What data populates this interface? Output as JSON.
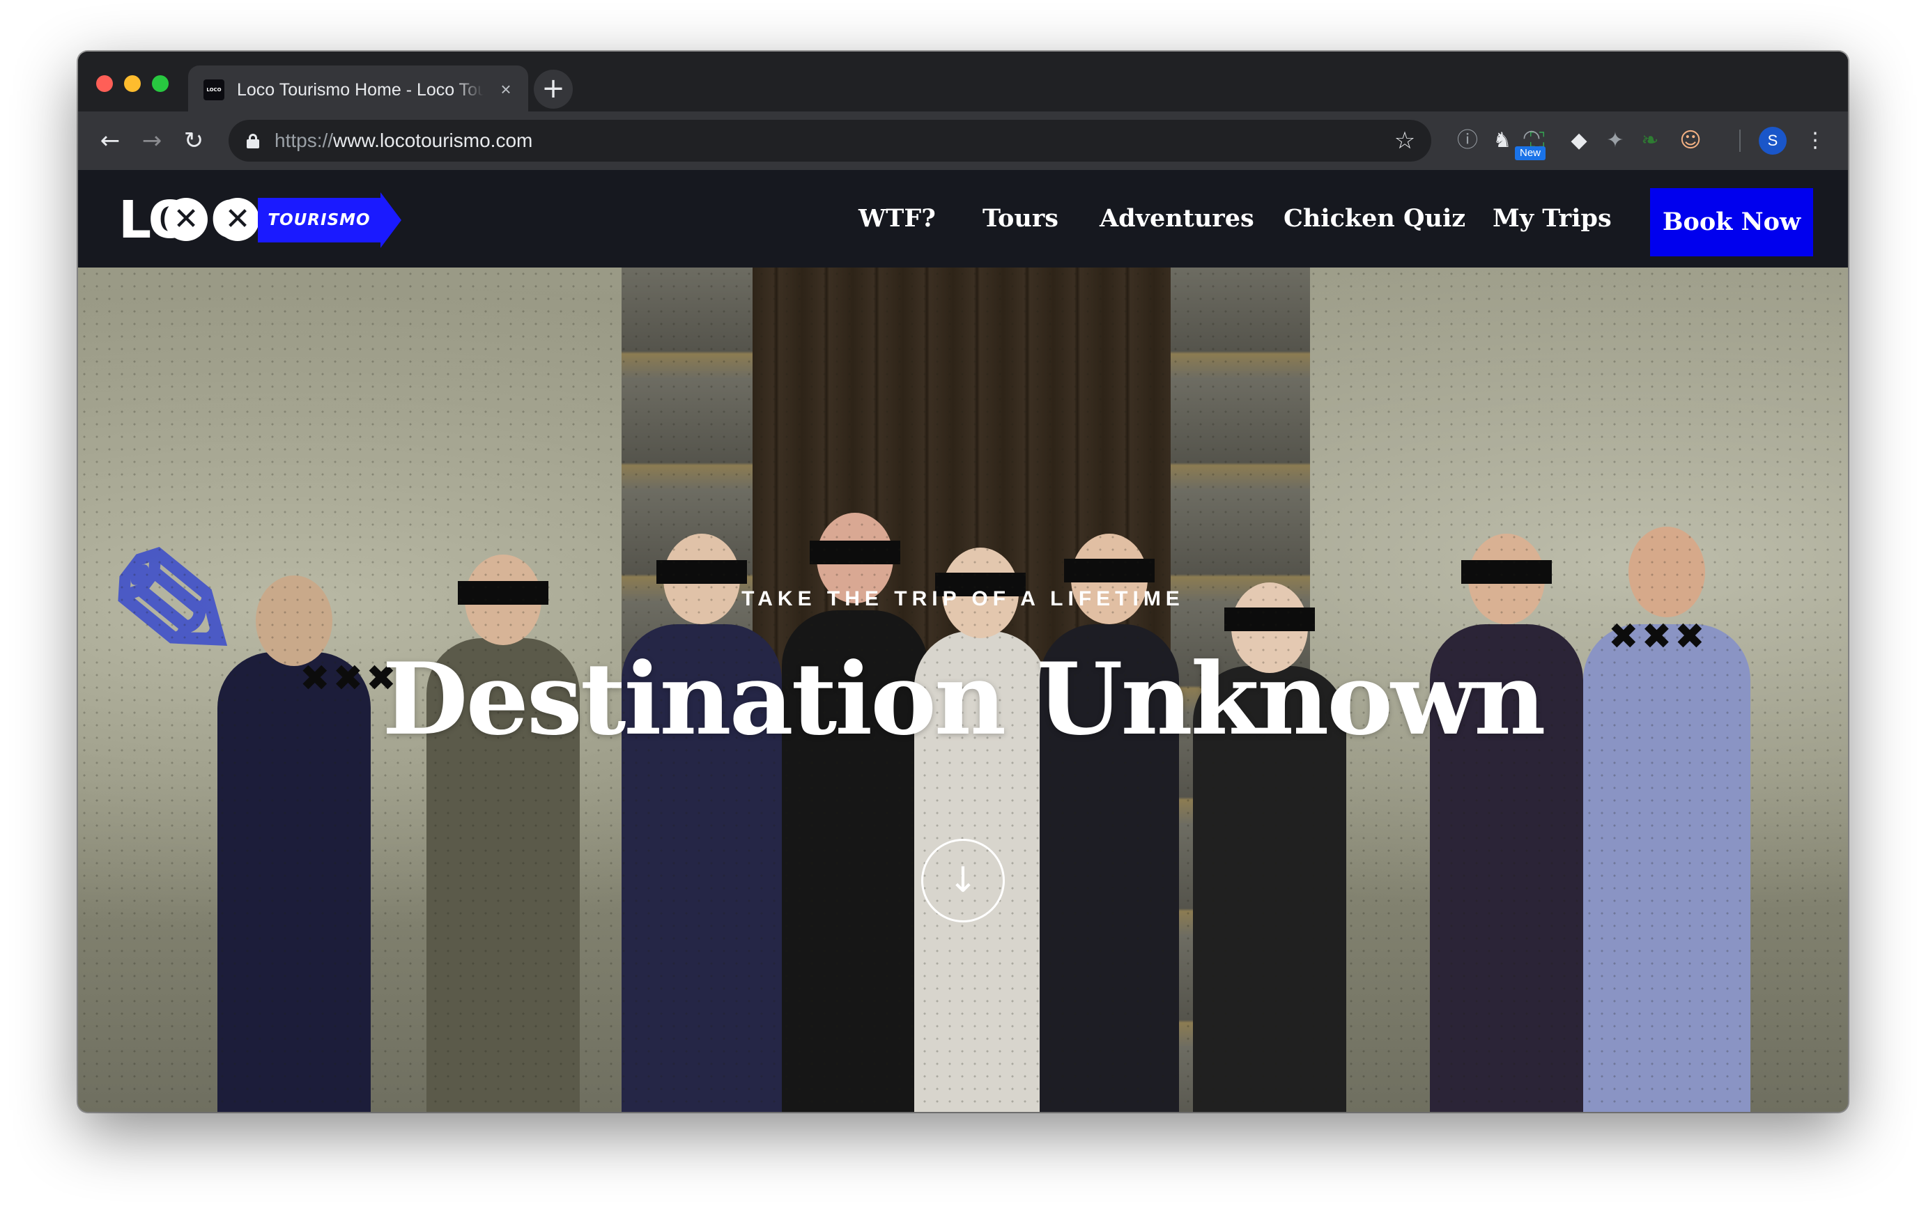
{
  "browser": {
    "tab": {
      "favicon_text": "LOCO",
      "title": "Loco Tourismo Home - Loco Tourismo",
      "close_icon": "×"
    },
    "new_tab_icon": "+",
    "nav": {
      "back": "←",
      "forward": "→",
      "reload": "↻"
    },
    "url": {
      "scheme": "https://",
      "host": "www.locotourismo.com"
    },
    "bookmark_icon": "☆",
    "extensions": [
      {
        "name": "info-extension-icon",
        "glyph": "ⓘ"
      },
      {
        "name": "horse-extension-icon",
        "glyph": "♞"
      },
      {
        "name": "screenshot-extension-icon",
        "glyph": "⛶"
      },
      {
        "name": "rainbow-extension-icon",
        "glyph": "◠"
      },
      {
        "name": "gem-extension-icon",
        "glyph": "◆"
      },
      {
        "name": "puzzle-extension-icon",
        "glyph": "✦"
      },
      {
        "name": "leaf-extension-icon",
        "glyph": "❧"
      },
      {
        "name": "face-extension-icon",
        "glyph": "☺"
      }
    ],
    "new_badge": "New",
    "profile_initial": "S",
    "menu_icon": "⋮"
  },
  "site": {
    "logo": {
      "word_a": "LO",
      "word_b": "C",
      "x_glyph": "✕",
      "banner": "TOURISMO"
    },
    "nav": [
      {
        "label": "WTF?"
      },
      {
        "label": "Tours"
      },
      {
        "label": "Adventures"
      },
      {
        "label": "Chicken Quiz"
      },
      {
        "label": "My Trips"
      }
    ],
    "cta": "Book Now",
    "hero": {
      "eyebrow": "TAKE THE TRIP OF A LIFETIME",
      "title": "Destination Unknown",
      "scroll_icon": "↓",
      "xxx_marks": "✖✖✖"
    }
  },
  "colors": {
    "browser_frame": "#202124",
    "toolbar": "#35363a",
    "site_header": "#16181f",
    "accent_blue": "#0000ee"
  }
}
